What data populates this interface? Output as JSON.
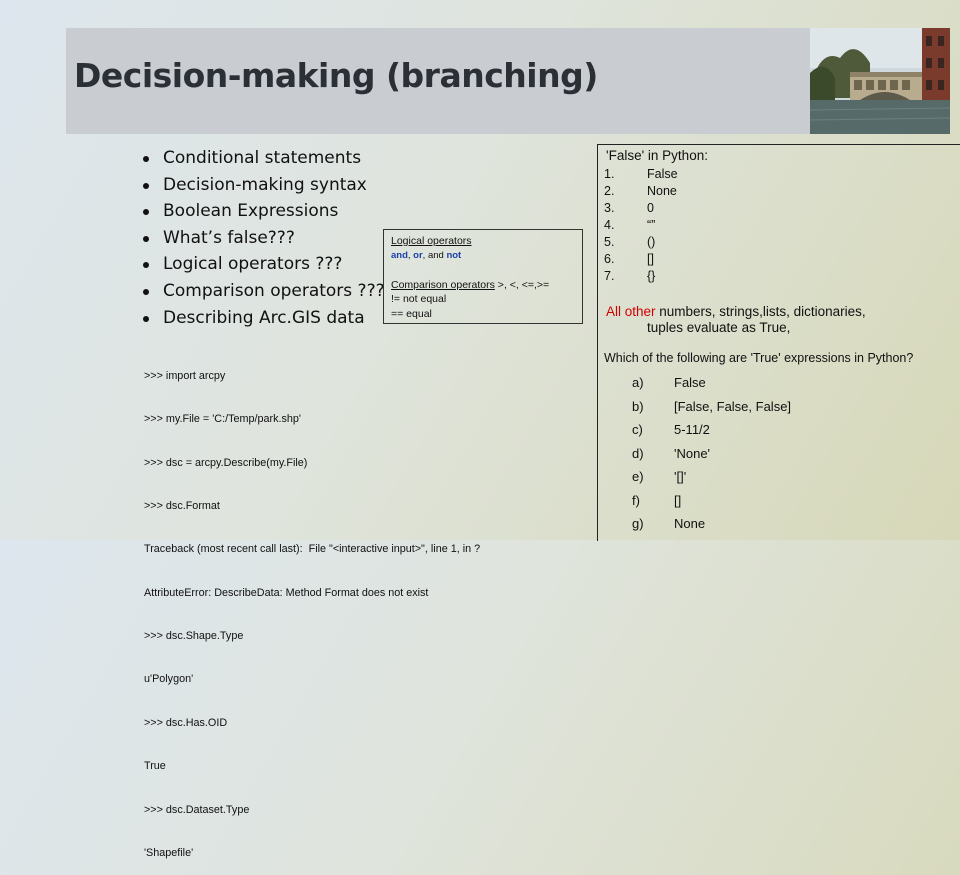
{
  "slide": {
    "title": "Decision-making (branching)"
  },
  "bullets": [
    "Conditional statements",
    "Decision-making syntax",
    "Boolean Expressions",
    "What’s false???",
    "Logical operators ???",
    "Comparison operators ???",
    "Describing Arc.GIS data"
  ],
  "operators_box": {
    "logical_heading": "Logical operators",
    "logical_and": "and",
    "logical_or": "or",
    "logical_sep1": ", ",
    "logical_sep2": ", and ",
    "logical_not": "not",
    "comparison_heading": "Comparison operators",
    "comparison_list": " >, <, <=,>=",
    "not_equal": "!= not equal",
    "equal": "== equal"
  },
  "console_lines": [
    ">>> import arcpy",
    ">>> my.File = 'C:/Temp/park.shp'",
    ">>> dsc = arcpy.Describe(my.File)",
    ">>> dsc.Format",
    "Traceback (most recent call last):  File \"<interactive input>\", line 1, in ?",
    "AttributeError: DescribeData: Method Format does not exist",
    ">>> dsc.Shape.Type",
    "u'Polygon'",
    ">>> dsc.Has.OID",
    "True",
    ">>> dsc.Dataset.Type",
    "'Shapefile'"
  ],
  "false_section": {
    "heading": "'False' in Python:",
    "items": [
      {
        "num": "1.",
        "value": "False"
      },
      {
        "num": "2.",
        "value": "None"
      },
      {
        "num": "3.",
        "value": "0"
      },
      {
        "num": "4.",
        "value": "“”"
      },
      {
        "num": "5.",
        "value": "()"
      },
      {
        "num": "6.",
        "value": "[]"
      },
      {
        "num": "7.",
        "value": "{}"
      }
    ]
  },
  "true_note": {
    "highlight": "All other",
    "rest_line1": " numbers, strings,lists, dictionaries,",
    "line2": "tuples evaluate as True,"
  },
  "quiz": {
    "question": "Which of the following are 'True' expressions in Python?",
    "options": [
      {
        "letter": "a)",
        "text": "False"
      },
      {
        "letter": "b)",
        "text": "[False, False, False]"
      },
      {
        "letter": "c)",
        "text": "5-11/2"
      },
      {
        "letter": "d)",
        "text": "'None'"
      },
      {
        "letter": "e)",
        "text": "'[]'"
      },
      {
        "letter": "f)",
        "text": "[]"
      },
      {
        "letter": "g)",
        "text": "None"
      }
    ]
  },
  "colors": {
    "keyword_blue": "#1b3fa8",
    "highlight_red": "#d00000",
    "title_band": "#c9cdd2"
  }
}
